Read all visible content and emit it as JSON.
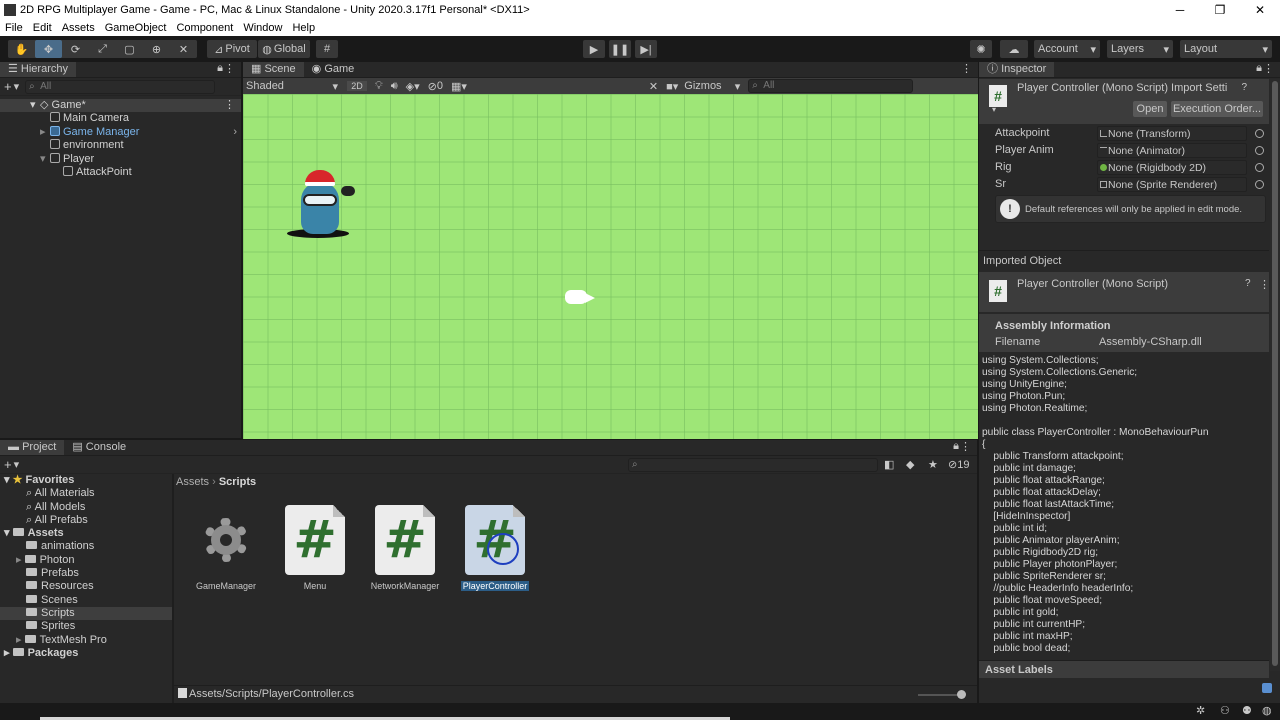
{
  "window": {
    "title": "2D RPG Multiplayer Game - Game - PC, Mac & Linux Standalone - Unity 2020.3.17f1 Personal* <DX11>",
    "controls": [
      "─",
      "❐",
      "✕"
    ]
  },
  "menu": [
    "File",
    "Edit",
    "Assets",
    "GameObject",
    "Component",
    "Window",
    "Help"
  ],
  "toolbar": {
    "pivot": "Pivot",
    "global": "Global",
    "account": "Account",
    "layers": "Layers",
    "layout": "Layout"
  },
  "hierarchy": {
    "tab": "Hierarchy",
    "search_placeholder": "All",
    "items": [
      {
        "label": "Game*",
        "indent": 0
      },
      {
        "label": "Main Camera",
        "indent": 1
      },
      {
        "label": "Game Manager",
        "indent": 1
      },
      {
        "label": "environment",
        "indent": 1
      },
      {
        "label": "Player",
        "indent": 1
      },
      {
        "label": "AttackPoint",
        "indent": 2
      }
    ]
  },
  "scene": {
    "tabs": [
      "Scene",
      "Game"
    ],
    "shading": "Shaded",
    "mode_2d": "2D",
    "fx_count": "0",
    "gizmos": "Gizmos",
    "search_placeholder": "All"
  },
  "inspector": {
    "tab": "Inspector",
    "header_title": "Player Controller (Mono Script) Import Setti",
    "open_button": "Open",
    "exec_order_button": "Execution Order...",
    "fields": [
      {
        "label": "Attackpoint",
        "value": "None (Transform)"
      },
      {
        "label": "Player Anim",
        "value": "None (Animator)"
      },
      {
        "label": "Rig",
        "value": "None (Rigidbody 2D)"
      },
      {
        "label": "Sr",
        "value": "None (Sprite Renderer)"
      }
    ],
    "info_message": "Default references will only be applied in edit mode.",
    "imported_object": "Imported Object",
    "imported_title": "Player Controller (Mono Script)",
    "assembly_info": "Assembly Information",
    "filename_label": "Filename",
    "filename_value": "Assembly-CSharp.dll",
    "code": "using System.Collections;\nusing System.Collections.Generic;\nusing UnityEngine;\nusing Photon.Pun;\nusing Photon.Realtime;\n\npublic class PlayerController : MonoBehaviourPun\n{\n    public Transform attackpoint;\n    public int damage;\n    public float attackRange;\n    public float attackDelay;\n    public float lastAttackTime;\n    [HideInInspector]\n    public int id;\n    public Animator playerAnim;\n    public Rigidbody2D rig;\n    public Player photonPlayer;\n    public SpriteRenderer sr;\n    //public HeaderInfo headerInfo;\n    public float moveSpeed;\n    public int gold;\n    public int currentHP;\n    public int maxHP;\n    public bool dead;",
    "asset_labels": "Asset Labels"
  },
  "project": {
    "tabs": [
      "Project",
      "Console"
    ],
    "hidden_count": "19",
    "favorites": "Favorites",
    "favorite_items": [
      "All Materials",
      "All Models",
      "All Prefabs"
    ],
    "assets_root": "Assets",
    "asset_folders": [
      "animations",
      "Photon",
      "Prefabs",
      "Resources",
      "Scenes",
      "Scripts",
      "Sprites",
      "TextMesh Pro"
    ],
    "packages": "Packages",
    "breadcrumb_root": "Assets",
    "breadcrumb_current": "Scripts",
    "assets": [
      {
        "name": "GameManager",
        "kind": "gear-icon"
      },
      {
        "name": "Menu",
        "kind": "script-icon"
      },
      {
        "name": "NetworkManager",
        "kind": "script-icon"
      },
      {
        "name": "PlayerController",
        "kind": "script-icon"
      }
    ],
    "path": "Assets/Scripts/PlayerController.cs"
  },
  "colors": {
    "scene_bg": "#9ee677",
    "selection": "#2c5d87",
    "panel": "#282828"
  }
}
